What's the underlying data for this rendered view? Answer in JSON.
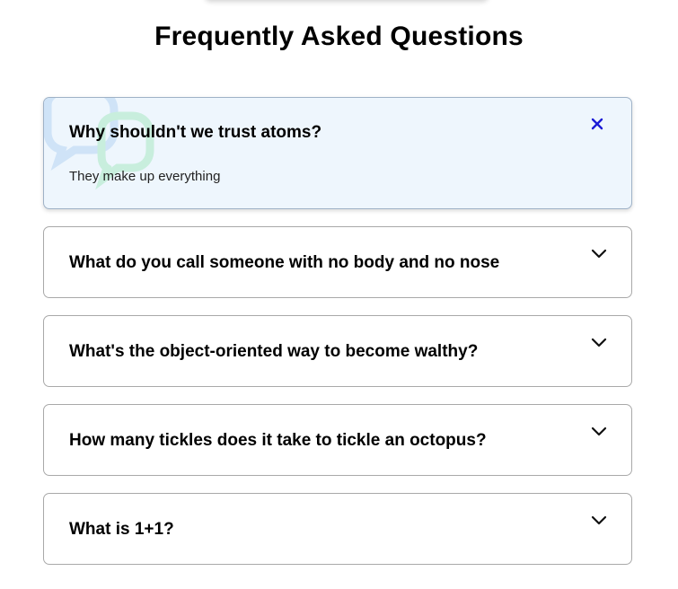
{
  "title": "Frequently Asked Questions",
  "faqs": [
    {
      "question": "Why shouldn't we trust atoms?",
      "answer": "They make up everything",
      "state": "expanded",
      "icon": "close-icon"
    },
    {
      "question": "What do you call someone with no body and no nose",
      "state": "collapsed",
      "icon": "chevron-down-icon"
    },
    {
      "question": "What's the object-oriented way to become walthy?",
      "state": "collapsed",
      "icon": "chevron-down-icon"
    },
    {
      "question": "How many tickles does it take to tickle an octopus?",
      "state": "collapsed",
      "icon": "chevron-down-icon"
    },
    {
      "question": "What is 1+1?",
      "state": "collapsed",
      "icon": "chevron-down-icon"
    }
  ],
  "colors": {
    "active_bg": "#eef6fd",
    "close_icon": "#1a1ad6",
    "bubble_blue": "#cfe3f7",
    "bubble_green": "#c8eedd"
  }
}
